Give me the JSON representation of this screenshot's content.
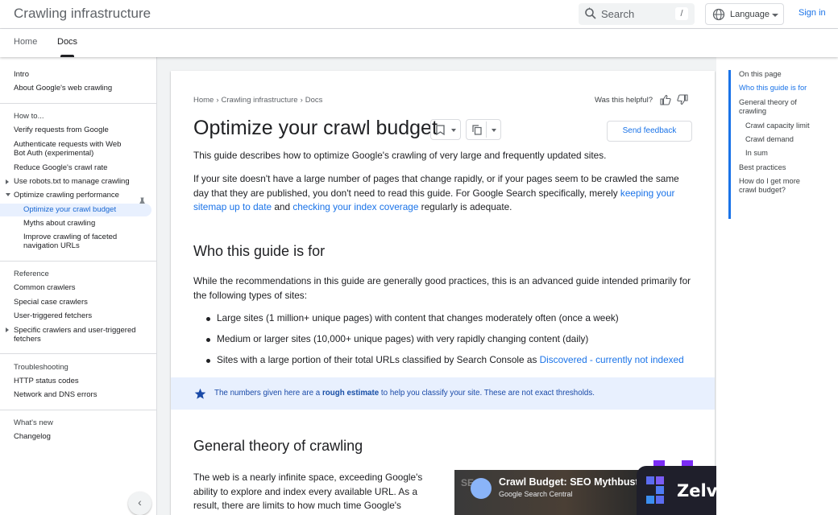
{
  "header": {
    "site_title": "Crawling infrastructure",
    "search_placeholder": "Search",
    "search_shortcut": "/",
    "language_label": "Language",
    "signin_label": "Sign in"
  },
  "tabs": [
    {
      "label": "Home"
    },
    {
      "label": "Docs"
    }
  ],
  "sidebar": {
    "items": [
      {
        "label": "Intro"
      },
      {
        "label": "About Google's web crawling"
      },
      {
        "label": "How to..."
      },
      {
        "label": "Verify requests from Google"
      },
      {
        "label": "Authenticate requests with Web Bot Auth (experimental)"
      },
      {
        "label": "Reduce Google's crawl rate"
      },
      {
        "label": "Use robots.txt to manage crawling"
      },
      {
        "label": "Optimize crawling performance"
      },
      {
        "label": "Optimize your crawl budget"
      },
      {
        "label": "Myths about crawling"
      },
      {
        "label": "Improve crawling of faceted navigation URLs"
      },
      {
        "label": "Reference"
      },
      {
        "label": "Common crawlers"
      },
      {
        "label": "Special case crawlers"
      },
      {
        "label": "User-triggered fetchers"
      },
      {
        "label": "Specific crawlers and user-triggered fetchers"
      },
      {
        "label": "Troubleshooting"
      },
      {
        "label": "HTTP status codes"
      },
      {
        "label": "Network and DNS errors"
      },
      {
        "label": "What's new"
      },
      {
        "label": "Changelog"
      }
    ],
    "collapse_label": "‹"
  },
  "breadcrumb": [
    "Home",
    "Crawling infrastructure",
    "Docs"
  ],
  "helpful_label": "Was this helpful?",
  "page_title": "Optimize your crawl budget",
  "feedback_label": "Send feedback",
  "content": {
    "intro": "This guide describes how to optimize Google's crawling of very large and frequently updated sites.",
    "p2_a": "If your site doesn't have a large number of pages that change rapidly, or if your pages seem to be crawled the same day that they are published, you don't need to read this guide. For Google Search specifically, merely ",
    "p2_link1": "keeping your sitemap up to date",
    "p2_b": " and ",
    "p2_link2": "checking your index coverage",
    "p2_c": " regularly is adequate.",
    "h_who": "Who this guide is for",
    "p3": "While the recommendations in this guide are generally good practices, this is an advanced guide intended primarily for the following types of sites:",
    "bullet1": "Large sites (1 million+ unique pages) with content that changes moderately often (once a week)",
    "bullet2": "Medium or larger sites (10,000+ unique pages) with very rapidly changing content (daily)",
    "bullet3_a": "Sites with a large portion of their total URLs classified by Search Console as ",
    "bullet3_link": "Discovered - currently not indexed",
    "note_a": "The numbers given here are a ",
    "note_b": "rough estimate",
    "note_c": " to help you classify your site. These are not exact thresholds.",
    "h_theory": "General theory of crawling",
    "p4": "The web is a nearly infinite space, exceeding Google's ability to explore and index every available URL. As a result, there are limits to how much time Google's"
  },
  "video": {
    "title": "Crawl Budget: SEO Mythbustin",
    "channel": "Google Search Central",
    "ghost": "SE"
  },
  "watermark": {
    "name": "Zelvarn"
  },
  "toc": {
    "heading": "On this page",
    "items": [
      {
        "label": "Who this guide is for"
      },
      {
        "label": "General theory of crawling"
      },
      {
        "label": "Crawl capacity limit"
      },
      {
        "label": "Crawl demand"
      },
      {
        "label": "In sum"
      },
      {
        "label": "Best practices"
      },
      {
        "label": "How do I get more crawl budget?"
      }
    ]
  },
  "colors": {
    "accent": "#1a73e8",
    "note_bg": "#e8f0fe",
    "selected_bg": "#e8f0fe",
    "brand_purple": "#7b2cf5"
  }
}
